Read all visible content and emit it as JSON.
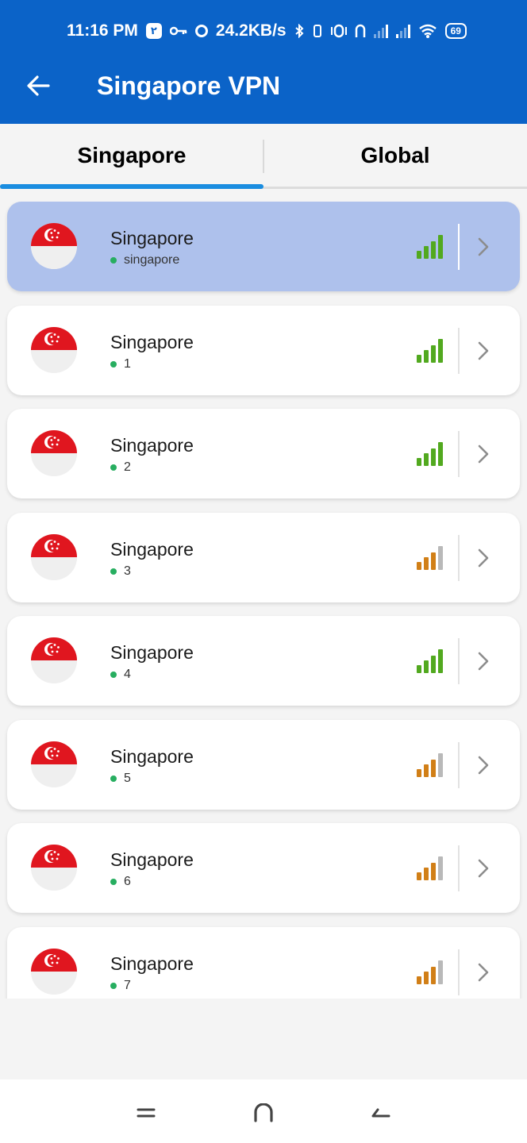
{
  "status_bar": {
    "time": "11:16 PM",
    "badge": "۲",
    "speed": "24.2KB/s",
    "battery": "69",
    "icons": [
      "key-icon",
      "circle-icon",
      "bluetooth-icon",
      "vibrate-icon",
      "data-icon",
      "signal-icon",
      "signal-icon",
      "wifi-icon",
      "battery-icon"
    ]
  },
  "header": {
    "title": "Singapore VPN",
    "back_icon": "arrow-left-icon"
  },
  "tabs": [
    {
      "label": "Singapore",
      "active": true
    },
    {
      "label": "Global",
      "active": false
    }
  ],
  "accent_color": "#1a8de0",
  "servers": [
    {
      "name": "Singapore",
      "sub": "singapore",
      "signal_level": 4,
      "signal_color": "#52a91f",
      "selected": true
    },
    {
      "name": "Singapore",
      "sub": "1",
      "signal_level": 4,
      "signal_color": "#52a91f",
      "selected": false
    },
    {
      "name": "Singapore",
      "sub": "2",
      "signal_level": 4,
      "signal_color": "#52a91f",
      "selected": false
    },
    {
      "name": "Singapore",
      "sub": "3",
      "signal_level": 3,
      "signal_color": "#d17f17",
      "selected": false
    },
    {
      "name": "Singapore",
      "sub": "4",
      "signal_level": 4,
      "signal_color": "#52a91f",
      "selected": false
    },
    {
      "name": "Singapore",
      "sub": "5",
      "signal_level": 3,
      "signal_color": "#d17f17",
      "selected": false
    },
    {
      "name": "Singapore",
      "sub": "6",
      "signal_level": 3,
      "signal_color": "#d17f17",
      "selected": false
    },
    {
      "name": "Singapore",
      "sub": "7",
      "signal_level": 3,
      "signal_color": "#d17f17",
      "selected": false
    }
  ],
  "nav_bar": {
    "icons": [
      "menu-icon",
      "home-icon",
      "back-icon"
    ]
  }
}
